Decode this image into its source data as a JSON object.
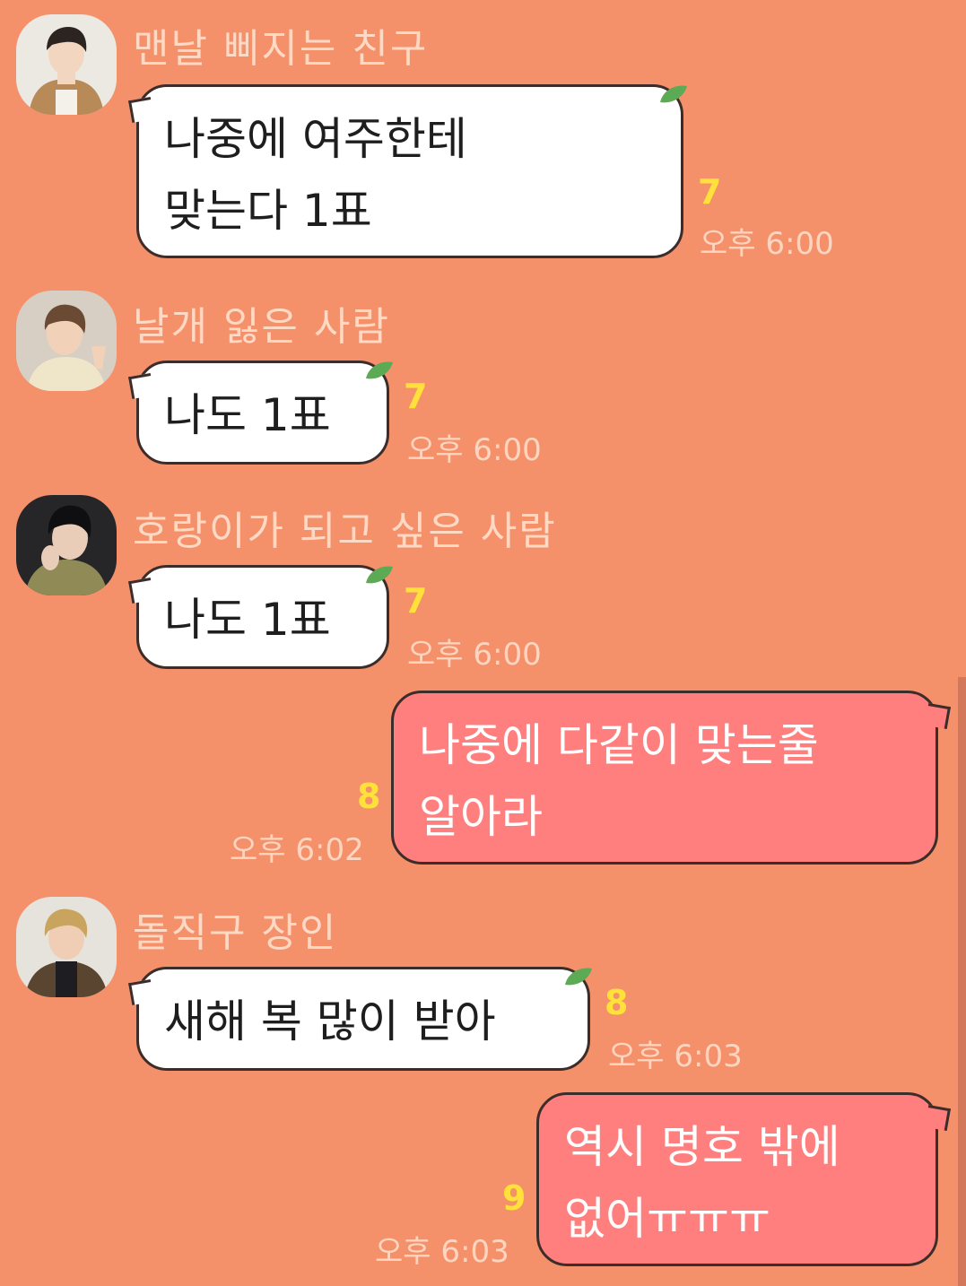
{
  "messages": [
    {
      "sender": "맨날 삐지는 친구",
      "avatar": "avatar-1",
      "lines": [
        "나중에 여주한테",
        "맞는다 1표"
      ],
      "unread": "7",
      "time": "오후 6:00"
    },
    {
      "sender": "날개 잃은 사람",
      "avatar": "avatar-2",
      "lines": [
        "나도 1표"
      ],
      "unread": "7",
      "time": "오후 6:00"
    },
    {
      "sender": "호랑이가 되고 싶은 사람",
      "avatar": "avatar-3",
      "lines": [
        "나도 1표"
      ],
      "unread": "7",
      "time": "오후 6:00"
    },
    {
      "sender": "",
      "lines": [
        "나중에 다같이 맞는줄",
        "알아라"
      ],
      "unread": "8",
      "time": "오후 6:02"
    },
    {
      "sender": "돌직구 장인",
      "avatar": "avatar-4",
      "lines": [
        "새해 복 많이 받아"
      ],
      "unread": "8",
      "time": "오후 6:03"
    },
    {
      "sender": "",
      "lines": [
        "역시 명호 밖에",
        "없어ㅠㅠㅠ"
      ],
      "unread": "9",
      "time": "오후 6:03"
    }
  ],
  "colors": {
    "background": "#f4916b",
    "incoming_bubble": "#ffffff",
    "outgoing_bubble": "#ff7f7e",
    "unread_count": "#ffe13a",
    "sender_name": "#ffd9c4"
  }
}
